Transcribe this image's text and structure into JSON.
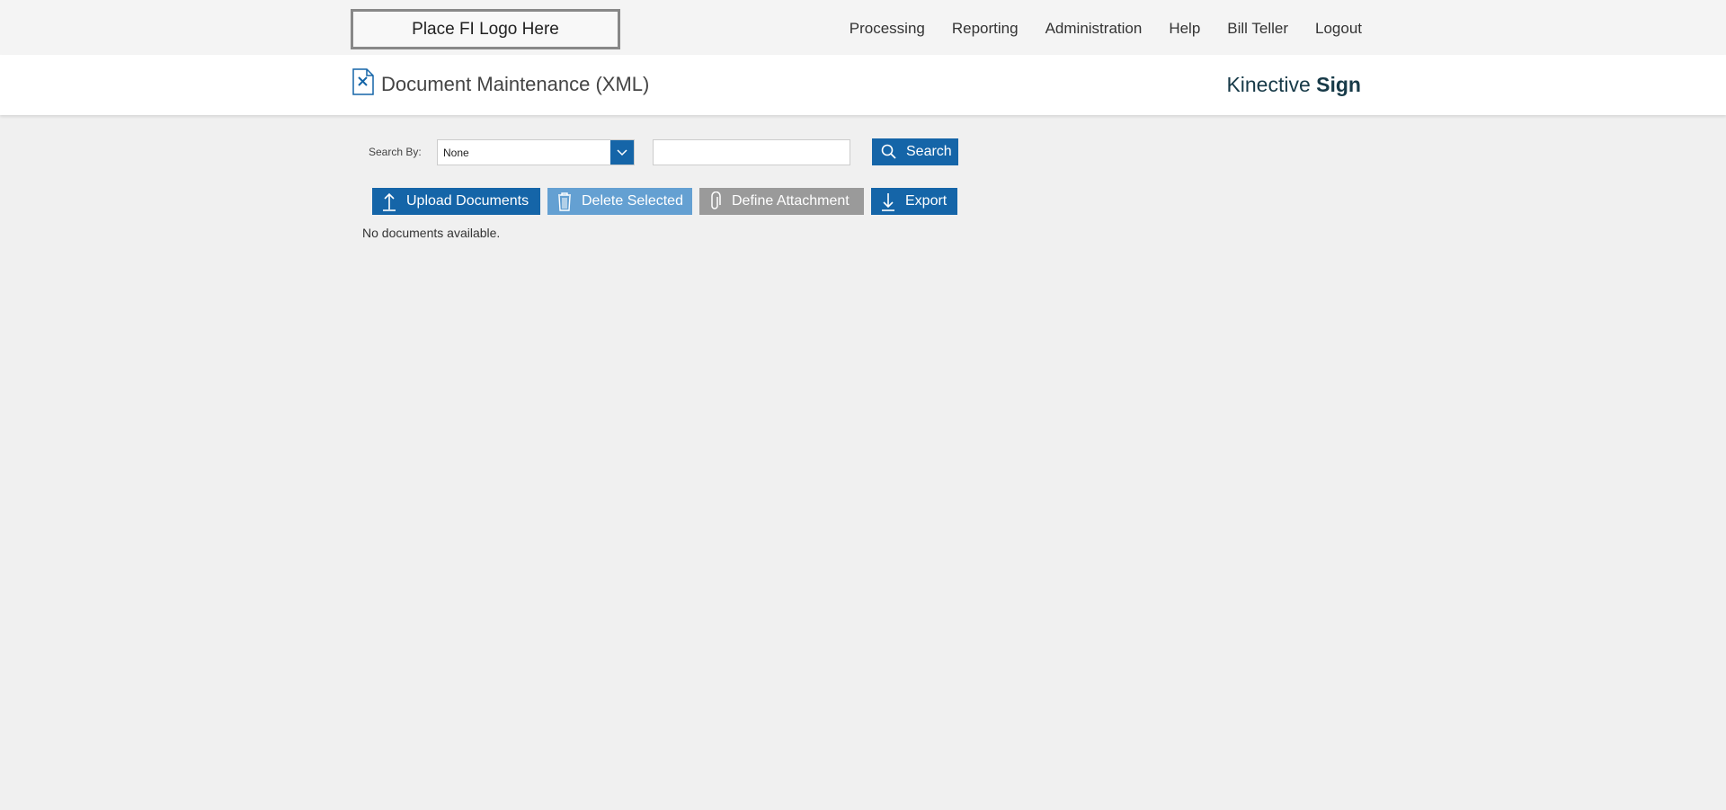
{
  "header": {
    "logo_text": "Place FI Logo Here",
    "nav": [
      {
        "label": "Processing"
      },
      {
        "label": "Reporting"
      },
      {
        "label": "Administration"
      },
      {
        "label": "Help"
      },
      {
        "label": "Bill Teller"
      },
      {
        "label": "Logout"
      }
    ]
  },
  "title_bar": {
    "icon": "document-maintenance-icon",
    "title": "Document Maintenance (XML)",
    "brand_light": "Kinective",
    "brand_bold": "Sign"
  },
  "search": {
    "label": "Search By:",
    "selected": "None",
    "input_value": "",
    "input_placeholder": "",
    "button_label": "Search"
  },
  "toolbar": {
    "upload_label": "Upload Documents",
    "delete_label": "Delete Selected",
    "define_label": "Define Attachment",
    "export_label": "Export"
  },
  "content": {
    "empty_message": "No documents available."
  },
  "colors": {
    "primary": "#1565a8",
    "disabled_blue": "#64a0d2",
    "disabled_gray": "#9a9a9a",
    "brand": "#173a48"
  }
}
